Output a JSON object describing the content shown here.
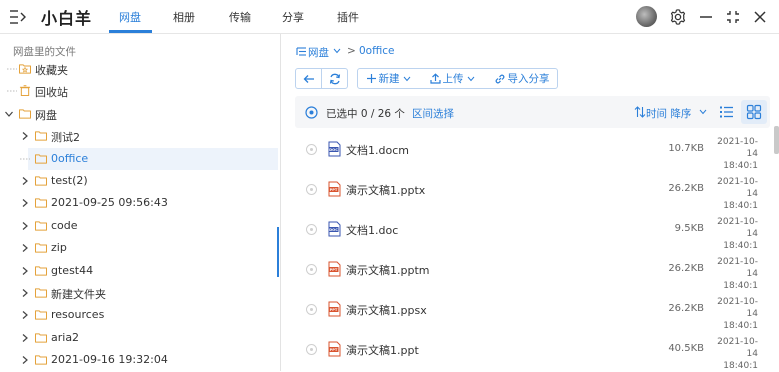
{
  "app": {
    "title": "小白羊",
    "nav_tabs": [
      {
        "label": "网盘",
        "active": true
      },
      {
        "label": "相册",
        "active": false
      },
      {
        "label": "传输",
        "active": false
      },
      {
        "label": "分享",
        "active": false
      },
      {
        "label": "插件",
        "active": false
      }
    ],
    "accent_color": "#2b7fd9",
    "window_controls": [
      "gear-icon",
      "minimize-icon",
      "fullscreen-icon",
      "close-icon"
    ]
  },
  "sidebar": {
    "heading": "网盘里的文件",
    "items": [
      {
        "label": "收藏夹",
        "icon": "star-folder-icon",
        "depth": 0,
        "expandable": false
      },
      {
        "label": "回收站",
        "icon": "trash-icon",
        "depth": 0,
        "expandable": false
      },
      {
        "label": "网盘",
        "icon": "folder-icon",
        "depth": 0,
        "expandable": true,
        "expanded": true
      },
      {
        "label": "测试2",
        "icon": "folder-icon",
        "depth": 1,
        "expandable": true
      },
      {
        "label": "0office",
        "icon": "folder-icon",
        "depth": 1,
        "expandable": false,
        "selected": true
      },
      {
        "label": "test(2)",
        "icon": "folder-icon",
        "depth": 1,
        "expandable": true
      },
      {
        "label": "2021-09-25 09:56:43",
        "icon": "folder-icon",
        "depth": 1,
        "expandable": true
      },
      {
        "label": "code",
        "icon": "folder-icon",
        "depth": 1,
        "expandable": true
      },
      {
        "label": "zip",
        "icon": "folder-icon",
        "depth": 1,
        "expandable": true
      },
      {
        "label": "gtest44",
        "icon": "folder-icon",
        "depth": 1,
        "expandable": true
      },
      {
        "label": "新建文件夹",
        "icon": "folder-icon",
        "depth": 1,
        "expandable": true
      },
      {
        "label": "resources",
        "icon": "folder-icon",
        "depth": 1,
        "expandable": true
      },
      {
        "label": "aria2",
        "icon": "folder-icon",
        "depth": 1,
        "expandable": true
      },
      {
        "label": "2021-09-16 19:32:04",
        "icon": "folder-icon",
        "depth": 1,
        "expandable": true
      }
    ]
  },
  "main": {
    "breadcrumb": {
      "root": "网盘",
      "sep": ">",
      "current": "0office"
    },
    "toolbar": {
      "new_label": "新建",
      "upload_label": "上传",
      "import_label": "导入分享"
    },
    "list_header": {
      "selection": "已选中 0 / 26 个",
      "range_select": "区间选择",
      "sort_label": "时间 降序"
    },
    "files": [
      {
        "name": "文档1.docm",
        "type": "doc",
        "size": "10.7KB",
        "date": "2021-10-14",
        "time": "18:40:1"
      },
      {
        "name": "演示文稿1.pptx",
        "type": "ppt",
        "size": "26.2KB",
        "date": "2021-10-14",
        "time": "18:40:1"
      },
      {
        "name": "文档1.doc",
        "type": "doc",
        "size": "9.5KB",
        "date": "2021-10-14",
        "time": "18:40:1"
      },
      {
        "name": "演示文稿1.pptm",
        "type": "ppt",
        "size": "26.2KB",
        "date": "2021-10-14",
        "time": "18:40:1"
      },
      {
        "name": "演示文稿1.ppsx",
        "type": "ppt",
        "size": "26.2KB",
        "date": "2021-10-14",
        "time": "18:40:1"
      },
      {
        "name": "演示文稿1.ppt",
        "type": "ppt",
        "size": "40.5KB",
        "date": "2021-10-14",
        "time": "18:40:1"
      }
    ]
  }
}
